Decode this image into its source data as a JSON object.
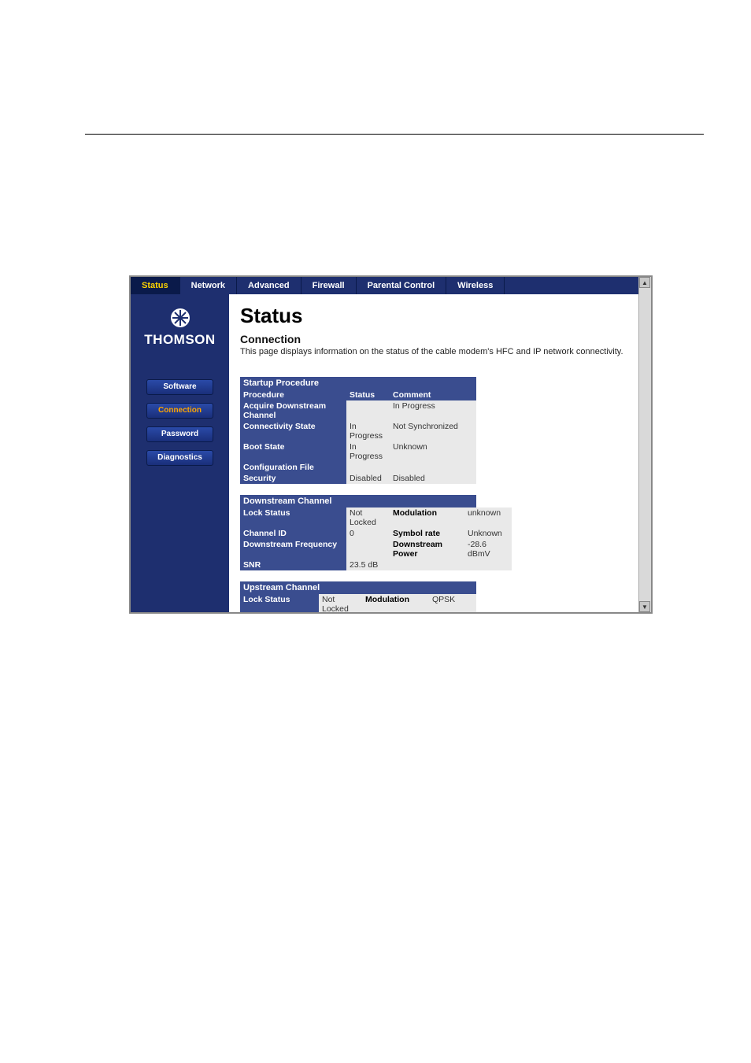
{
  "top_nav": {
    "status": "Status",
    "network": "Network",
    "advanced": "Advanced",
    "firewall": "Firewall",
    "parental": "Parental Control",
    "wireless": "Wireless"
  },
  "brand": "THOMSON",
  "sidebar": {
    "software": "Software",
    "connection": "Connection",
    "password": "Password",
    "diagnostics": "Diagnostics"
  },
  "page": {
    "title": "Status",
    "subtitle": "Connection",
    "description": "This page displays information on the status of the cable modem's HFC and IP network connectivity."
  },
  "startup": {
    "heading": "Startup Procedure",
    "cols": {
      "proc": "Procedure",
      "status": "Status",
      "comment": "Comment"
    },
    "rows": [
      {
        "proc": "Acquire Downstream Channel",
        "status": "",
        "comment": "In Progress"
      },
      {
        "proc": "Connectivity State",
        "status": "In Progress",
        "comment": "Not Synchronized"
      },
      {
        "proc": "Boot State",
        "status": "In Progress",
        "comment": "Unknown"
      },
      {
        "proc": "Configuration File",
        "status": "",
        "comment": ""
      },
      {
        "proc": "Security",
        "status": "Disabled",
        "comment": "Disabled"
      }
    ]
  },
  "downstream": {
    "heading": "Downstream Channel",
    "rows": [
      {
        "l1": "Lock Status",
        "v1": "Not Locked",
        "l2": "Modulation",
        "v2": "unknown"
      },
      {
        "l1": "Channel ID",
        "v1": "0",
        "l2": "Symbol rate",
        "v2": "Unknown"
      },
      {
        "l1": "Downstream Frequency",
        "v1": "",
        "l2": "Downstream Power",
        "v2": "-28.6 dBmV"
      },
      {
        "l1": "SNR",
        "v1": "23.5 dB",
        "l2": "",
        "v2": ""
      }
    ]
  },
  "upstream": {
    "heading": "Upstream Channel",
    "rows": [
      {
        "l1": "Lock Status",
        "v1": "Not Locked",
        "l2": "Modulation",
        "v2": "QPSK"
      }
    ]
  }
}
